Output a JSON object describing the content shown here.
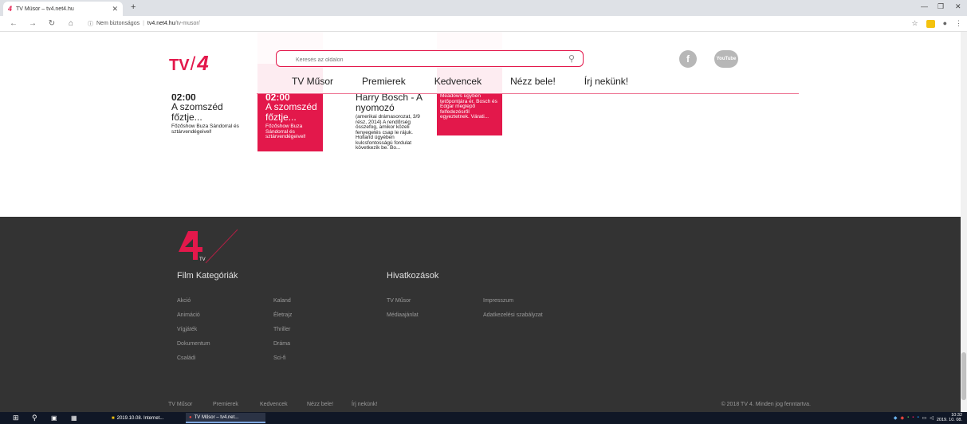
{
  "browser": {
    "tab_title": "TV Műsor – tv4.net4.hu",
    "tab_favicon": "4",
    "security_label": "Nem biztonságos",
    "url_host": "tv4.net4.hu",
    "url_path": "/tv-musor/"
  },
  "header": {
    "logo_tv": "TV",
    "logo_four": "4",
    "search_placeholder": "Keresés az oldalon",
    "social_fb": "f",
    "social_yt": "YouTube",
    "nav": [
      "TV Műsor",
      "Premierek",
      "Kedvencek",
      "Nézz bele!",
      "Írj nekünk!"
    ]
  },
  "schedule": [
    {
      "time": "02:00",
      "title": "A szomszéd főztje...",
      "desc": "Főzőshow Buza Sándorral és sztárvendégeivel!",
      "highlight": false
    },
    {
      "time": "02:00",
      "title": "A szomszéd főztje...",
      "desc": "Főzőshow Buza Sándorral és sztárvendégeivel!",
      "highlight": true
    },
    {
      "time": "",
      "title": "Harry Bosch - A nyomozó",
      "desc": "(amerikai drámasorozat, 3/9 rész, 2014) A rendőrség összefog, amikor közeli fenyegetés csap le rájuk. Holland ügyében kulcsfontosságú fordulat következik be. Bo...",
      "highlight": false
    },
    {
      "time": "",
      "title": "",
      "desc": "Meadows ügyben tetőpontjára ér. Bosch és Edgar meglepő felfedezésről egyeztetnek. Várati...",
      "highlight": true
    }
  ],
  "footer": {
    "film_heading": "Film Kategóriák",
    "links_heading": "Hivatkozások",
    "film_col1": [
      "Akció",
      "Animáció",
      "Vígjáték",
      "Dokumentum",
      "Családi"
    ],
    "film_col2": [
      "Kaland",
      "Életrajz",
      "Thriller",
      "Dráma",
      "Sci-fi"
    ],
    "links_col1": [
      "TV Műsor",
      "Médiaajánlat"
    ],
    "links_col2": [
      "Impresszum",
      "Adatkezelési szabályzat"
    ],
    "bottom_nav": [
      "TV Műsor",
      "Premierek",
      "Kedvencek",
      "Nézz bele!",
      "Írj nekünk!"
    ],
    "copyright": "© 2018 TV 4. Minden jog fenntartva."
  },
  "taskbar": {
    "app1": "2019.10.08. Internet...",
    "app2": "TV Műsor – tv4.net...",
    "time": "10:32",
    "date": "2019. 10. 08."
  },
  "colors": {
    "brand": "#e3184b",
    "footer_bg": "#333333"
  }
}
